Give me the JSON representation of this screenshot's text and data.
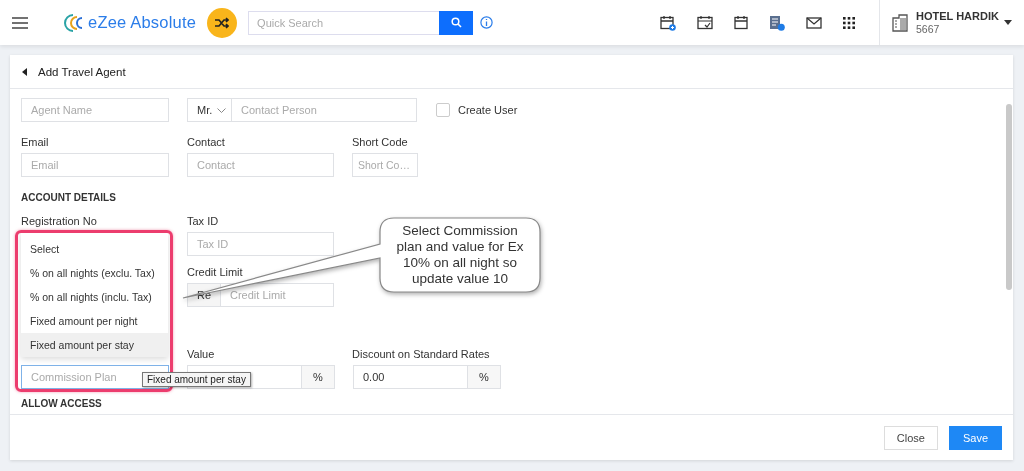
{
  "topbar": {
    "app_name": "eZee Absolute",
    "search": {
      "placeholder": "Quick Search"
    },
    "hotel": {
      "name": "HOTEL HARDIK",
      "code": "5667"
    }
  },
  "page": {
    "title": "Add Travel Agent"
  },
  "form": {
    "agent_name": {
      "placeholder": "Agent Name"
    },
    "contact_person": {
      "salutation": "Mr.",
      "placeholder": "Contact Person"
    },
    "create_user": {
      "label": "Create User",
      "checked": false
    },
    "email": {
      "label": "Email",
      "placeholder": "Email"
    },
    "contact": {
      "label": "Contact",
      "placeholder": "Contact"
    },
    "short_code": {
      "label": "Short Code",
      "placeholder": "Short Co…"
    },
    "account_section": "ACCOUNT DETAILS",
    "registration_no": {
      "label": "Registration No"
    },
    "tax_id": {
      "label": "Tax ID",
      "placeholder": "Tax ID"
    },
    "credit_limit": {
      "label": "Credit Limit",
      "prefix": "Re",
      "placeholder": "Credit Limit"
    },
    "commission_plan": {
      "placeholder": "Commission Plan",
      "options": [
        {
          "label": "Select",
          "selected": false
        },
        {
          "label": "% on all nights (exclu. Tax)",
          "selected": false
        },
        {
          "label": "% on all nights (inclu. Tax)",
          "selected": false
        },
        {
          "label": "Fixed amount per night",
          "selected": false
        },
        {
          "label": "Fixed amount per stay",
          "selected": true
        }
      ]
    },
    "value": {
      "label": "Value",
      "unit": "%"
    },
    "discount": {
      "label": "Discount on Standard Rates",
      "value": "0.00",
      "unit": "%"
    },
    "access_section": "ALLOW ACCESS"
  },
  "tooltip": "Fixed amount per stay",
  "annotation": "Select Commission plan and value for Ex 10% on all night so update value 10",
  "buttons": [
    {
      "label": "Close",
      "kind": "secondary"
    },
    {
      "label": "Save",
      "kind": "primary"
    }
  ]
}
